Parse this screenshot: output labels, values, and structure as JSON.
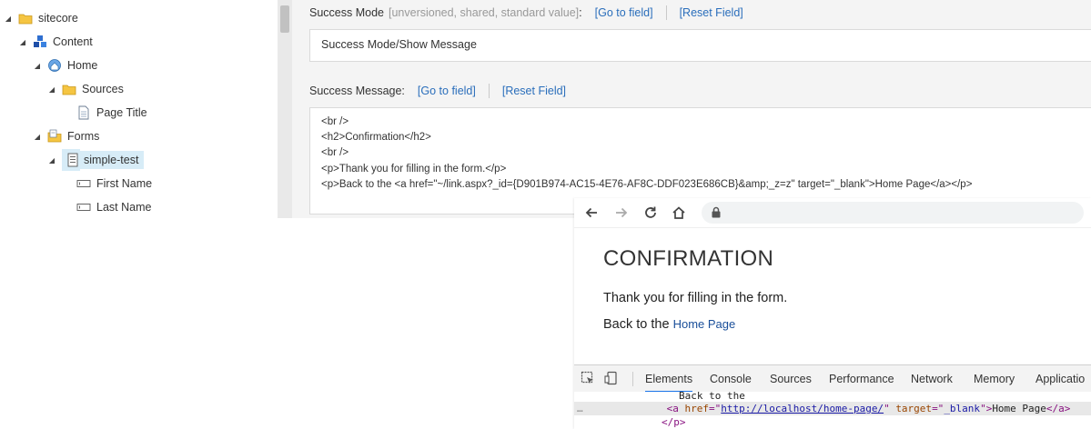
{
  "tree": {
    "items": [
      {
        "label": "sitecore",
        "icon": "folder-icon"
      },
      {
        "label": "Content",
        "icon": "cubes-icon"
      },
      {
        "label": "Home",
        "icon": "home-globe-icon"
      },
      {
        "label": "Sources",
        "icon": "folder-icon"
      },
      {
        "label": "Page Title",
        "icon": "document-icon"
      },
      {
        "label": "Forms",
        "icon": "forms-folder-icon"
      },
      {
        "label": "simple-test",
        "icon": "form-icon"
      },
      {
        "label": "First Name",
        "icon": "textbox-icon"
      },
      {
        "label": "Last Name",
        "icon": "textbox-icon"
      }
    ]
  },
  "editor": {
    "success_mode": {
      "label": "Success Mode",
      "meta": "[unversioned, shared, standard value]",
      "colon": ":",
      "goto": "[Go to field]",
      "reset": "[Reset Field]",
      "value": "Success Mode/Show Message"
    },
    "success_message": {
      "label": "Success Message:",
      "goto": "[Go to field]",
      "reset": "[Reset Field]",
      "lines": [
        "<br />",
        "<h2>Confirmation</h2>",
        "<br />",
        "<p>Thank you for filling in the form.</p>",
        "<p>Back to the <a href=\"~/link.aspx?_id={D901B974-AC15-4E76-AF8C-DDF023E686CB}&amp;_z=z\" target=\"_blank\">Home Page</a></p>"
      ]
    }
  },
  "browser": {
    "heading": "CONFIRMATION",
    "para1": "Thank you for filling in the form.",
    "para2_prefix": "Back to the ",
    "para2_link": "Home Page",
    "devtools_tabs": [
      "Elements",
      "Console",
      "Sources",
      "Performance",
      "Network",
      "Memory",
      "Applicatio"
    ],
    "dom": {
      "line1": "Back to the",
      "dots": "…",
      "a_open": "<a",
      "href_attr": "href",
      "eq_q": "=\"",
      "href_val": "http://localhost/home-page/",
      "q": "\"",
      "target_attr": "target",
      "target_val": "_blank",
      "gt": ">",
      "link_text": "Home Page",
      "a_close": "</a>",
      "p_close": "</p>"
    }
  },
  "colors": {
    "link": "#2a6ebb",
    "selection": "#d7ecf7",
    "devtools_active": "#1a73e8"
  }
}
